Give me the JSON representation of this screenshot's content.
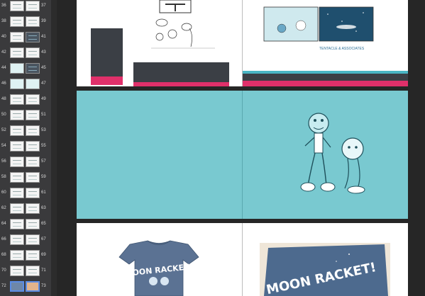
{
  "thumbnails": [
    {
      "left": "36",
      "right": "37",
      "left_style": "sketch",
      "right_style": "sketch"
    },
    {
      "left": "38",
      "right": "39",
      "left_style": "sketch",
      "right_style": "sketch"
    },
    {
      "left": "40",
      "right": "41",
      "left_style": "sketch",
      "right_style": "dark"
    },
    {
      "left": "42",
      "right": "43",
      "left_style": "sketch",
      "right_style": "sketch"
    },
    {
      "left": "44",
      "right": "45",
      "left_style": "teal",
      "right_style": "dark"
    },
    {
      "left": "46",
      "right": "47",
      "left_style": "teal",
      "right_style": "teal"
    },
    {
      "left": "48",
      "right": "49",
      "left_style": "sketch",
      "right_style": "sketch"
    },
    {
      "left": "50",
      "right": "51",
      "left_style": "sketch",
      "right_style": "sketch"
    },
    {
      "left": "52",
      "right": "53",
      "left_style": "sketch",
      "right_style": "sketch"
    },
    {
      "left": "54",
      "right": "55",
      "left_style": "sketch",
      "right_style": "sketch"
    },
    {
      "left": "56",
      "right": "57",
      "left_style": "sketch",
      "right_style": "sketch"
    },
    {
      "left": "58",
      "right": "59",
      "left_style": "sketch",
      "right_style": "sketch"
    },
    {
      "left": "60",
      "right": "61",
      "left_style": "sketch",
      "right_style": "sketch"
    },
    {
      "left": "62",
      "right": "63",
      "left_style": "sketch",
      "right_style": "sketch"
    },
    {
      "left": "64",
      "right": "65",
      "left_style": "sketch",
      "right_style": "sketch"
    },
    {
      "left": "66",
      "right": "67",
      "left_style": "sketch",
      "right_style": "sketch"
    },
    {
      "left": "68",
      "right": "69",
      "left_style": "sketch",
      "right_style": "sketch"
    },
    {
      "left": "70",
      "right": "71",
      "left_style": "sketch",
      "right_style": "sketch"
    },
    {
      "left": "72",
      "right": "73",
      "left_style": "blue",
      "right_style": "photo"
    }
  ],
  "selected_spread": "72",
  "comic_caption": "TENTACLE & ASSOCIATES",
  "tshirt_text": "MOON RACKET!",
  "tshirt_text_photo": "MOON RACKET!",
  "colors": {
    "accent_pink": "#e0306a",
    "teal_page": "#79c9d0",
    "selection_blue": "#5b8de6"
  }
}
